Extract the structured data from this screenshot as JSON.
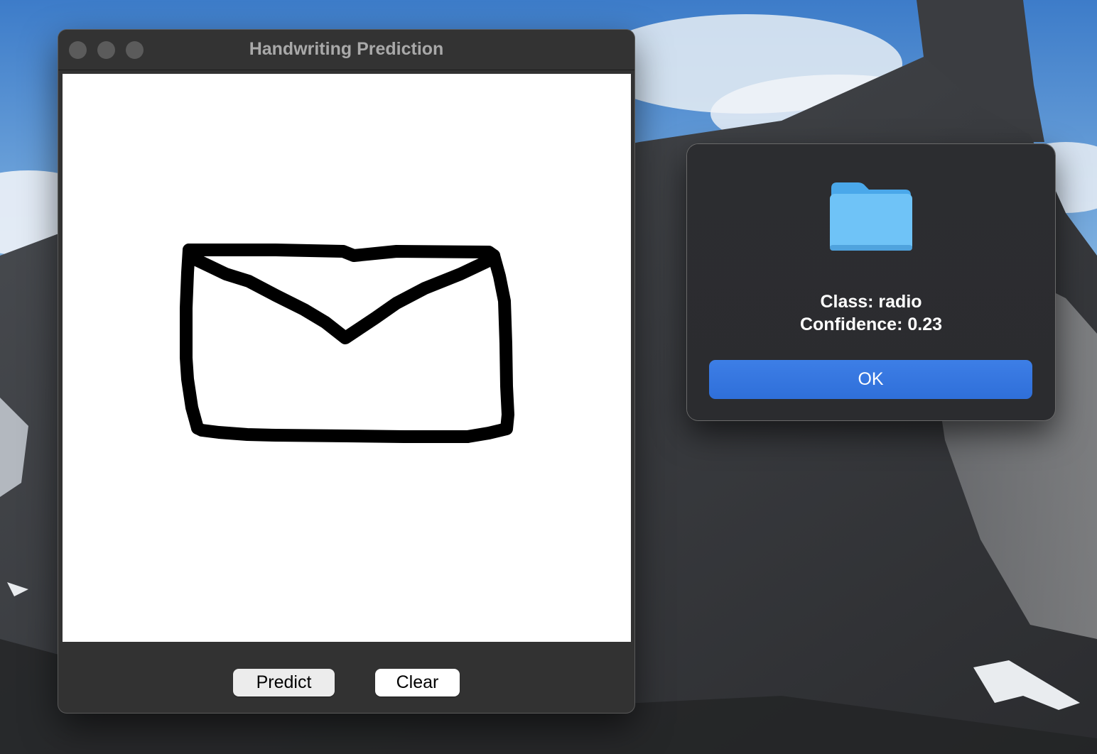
{
  "window": {
    "title": "Handwriting Prediction",
    "buttons": {
      "predict": "Predict",
      "clear": "Clear"
    }
  },
  "alert": {
    "icon": "folder-icon",
    "class_text": "Class: radio",
    "confidence_text": "Confidence: 0.23",
    "ok_label": "OK"
  },
  "colors": {
    "accent": "#3478f6",
    "folder": "#6fc3f7",
    "window_bg": "#323232",
    "canvas_bg": "#ffffff"
  }
}
